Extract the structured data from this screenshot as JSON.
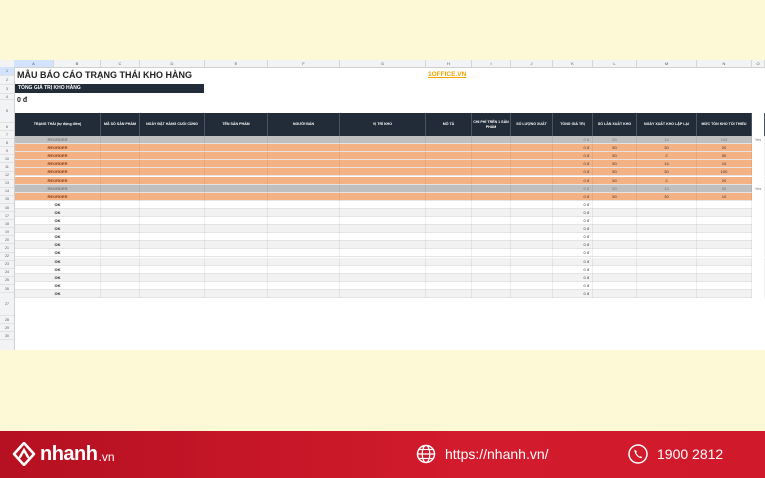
{
  "sheet": {
    "title": "MẪU BÁO CÁO TRẠNG THÁI KHO HÀNG",
    "brand_link": "1OFFICE.VN",
    "total_label": "TỔNG GIÁ TRỊ KHO HÀNG",
    "total_value": "0 đ",
    "col_letters": [
      "A",
      "B",
      "C",
      "D",
      "E",
      "F",
      "G",
      "H",
      "I",
      "J",
      "K",
      "L",
      "M",
      "N",
      "O"
    ],
    "row_numbers": [
      "1",
      "2",
      "3",
      "4",
      "5",
      "6",
      "7",
      "8",
      "9",
      "10",
      "11",
      "12",
      "13",
      "14",
      "15",
      "16",
      "17",
      "18",
      "19",
      "20",
      "21",
      "22",
      "23",
      "24",
      "25",
      "26",
      "27",
      "28",
      "29",
      "30"
    ],
    "headers": [
      "TRẠNG THÁI (tự động điền)",
      "MÃ SỐ SẢN PHẨM",
      "NGÀY ĐẶT HÀNG CUỐI CÙNG",
      "TÊN SẢN PHẨM",
      "NGƯỜI BÁN",
      "VỊ TRÍ KHO",
      "MÔ TẢ",
      "CHI PHÍ TRÊN 1 SẢN PHẨM",
      "SỐ LƯỢNG XUẤT",
      "TỔNG GIÁ TRỊ",
      "SỐ LẦN XUẤT KHO",
      "NGÀY XUẤT KHO LẶP LẠI",
      "MỨC TỒN KHO TỐI THIỂU",
      "SẢN PHẨM ĐÃ TỪ CHỐI?"
    ],
    "rows": [
      {
        "status": "REORDER",
        "total": "0 đ",
        "times": "50",
        "days": "14",
        "min": "100",
        "rejected": "Yes",
        "kind": "gray"
      },
      {
        "status": "REORDER",
        "total": "0 đ",
        "times": "50",
        "days": "30",
        "min": "20",
        "rejected": "",
        "kind": "orange"
      },
      {
        "status": "REORDER",
        "total": "0 đ",
        "times": "50",
        "days": "2",
        "min": "50",
        "rejected": "",
        "kind": "orange"
      },
      {
        "status": "REORDER",
        "total": "0 đ",
        "times": "50",
        "days": "14",
        "min": "10",
        "rejected": "",
        "kind": "orange"
      },
      {
        "status": "REORDER",
        "total": "0 đ",
        "times": "50",
        "days": "30",
        "min": "100",
        "rejected": "",
        "kind": "orange"
      },
      {
        "status": "REORDER",
        "total": "0 đ",
        "times": "50",
        "days": "2",
        "min": "20",
        "rejected": "",
        "kind": "orange"
      },
      {
        "status": "REORDER",
        "total": "0 đ",
        "times": "50",
        "days": "14",
        "min": "50",
        "rejected": "Yes",
        "kind": "gray"
      },
      {
        "status": "REORDER",
        "total": "0 đ",
        "times": "50",
        "days": "30",
        "min": "10",
        "rejected": "",
        "kind": "orange"
      },
      {
        "status": "OK",
        "total": "0 đ",
        "times": "",
        "days": "",
        "min": "",
        "rejected": "",
        "kind": "white"
      },
      {
        "status": "OK",
        "total": "0 đ",
        "times": "",
        "days": "",
        "min": "",
        "rejected": "",
        "kind": "alt"
      },
      {
        "status": "OK",
        "total": "0 đ",
        "times": "",
        "days": "",
        "min": "",
        "rejected": "",
        "kind": "white"
      },
      {
        "status": "OK",
        "total": "0 đ",
        "times": "",
        "days": "",
        "min": "",
        "rejected": "",
        "kind": "alt"
      },
      {
        "status": "OK",
        "total": "0 đ",
        "times": "",
        "days": "",
        "min": "",
        "rejected": "",
        "kind": "white"
      },
      {
        "status": "OK",
        "total": "0 đ",
        "times": "",
        "days": "",
        "min": "",
        "rejected": "",
        "kind": "alt"
      },
      {
        "status": "OK",
        "total": "0 đ",
        "times": "",
        "days": "",
        "min": "",
        "rejected": "",
        "kind": "white"
      },
      {
        "status": "OK",
        "total": "0 đ",
        "times": "",
        "days": "",
        "min": "",
        "rejected": "",
        "kind": "alt"
      },
      {
        "status": "OK",
        "total": "0 đ",
        "times": "",
        "days": "",
        "min": "",
        "rejected": "",
        "kind": "white"
      },
      {
        "status": "OK",
        "total": "0 đ",
        "times": "",
        "days": "",
        "min": "",
        "rejected": "",
        "kind": "alt"
      },
      {
        "status": "OK",
        "total": "0 đ",
        "times": "",
        "days": "",
        "min": "",
        "rejected": "",
        "kind": "white"
      },
      {
        "status": "OK",
        "total": "0 đ",
        "times": "",
        "days": "",
        "min": "",
        "rejected": "",
        "kind": "alt"
      }
    ]
  },
  "footer": {
    "logo_text": "nhanh",
    "logo_tld": ".vn",
    "website": "https://nhanh.vn/",
    "phone": "1900 2812"
  },
  "colors": {
    "header_dark": "#222b38",
    "reorder_orange": "#f4b183",
    "reorder_gray": "#bfbfbf",
    "brand_red": "#d21b2c",
    "link_orange": "#f5a300"
  },
  "icons": [
    "nhanh-logo-icon",
    "globe-icon",
    "phone-icon"
  ]
}
